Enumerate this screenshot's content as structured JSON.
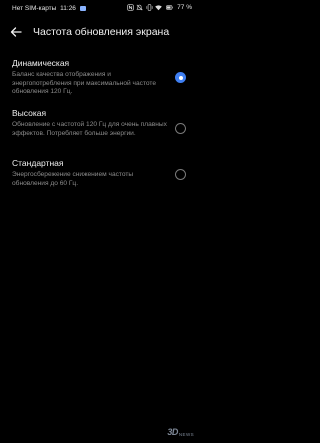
{
  "status_bar": {
    "carrier": "Нет SIM-карты",
    "time": "11:26",
    "battery_percent": "77 %",
    "icons": [
      "sim-chip-icon",
      "nfc-icon",
      "mute-icon",
      "vibrate-icon",
      "wifi-icon",
      "battery-icon"
    ]
  },
  "header": {
    "title": "Частота обновления экрана",
    "back_icon": "arrow-left-icon"
  },
  "options": [
    {
      "title": "Динамическая",
      "description": "Баланс качества отображения и энергопотребления при максимальной частоте обновления 120 Гц.",
      "selected": true
    },
    {
      "title": "Высокая",
      "description": "Обновление с частотой 120 Гц для очень плавных эффектов. Потребляет больше энергии.",
      "selected": false
    },
    {
      "title": "Стандартная",
      "description": "Энергосбережение снижением частоты обновления до 60 Гц.",
      "selected": false
    }
  ],
  "colors": {
    "background": "#000000",
    "accent": "#3f7ff2",
    "description_text": "#8c8c8c"
  },
  "watermark": {
    "logo_text": "3D",
    "sub_text": "NEWS"
  }
}
